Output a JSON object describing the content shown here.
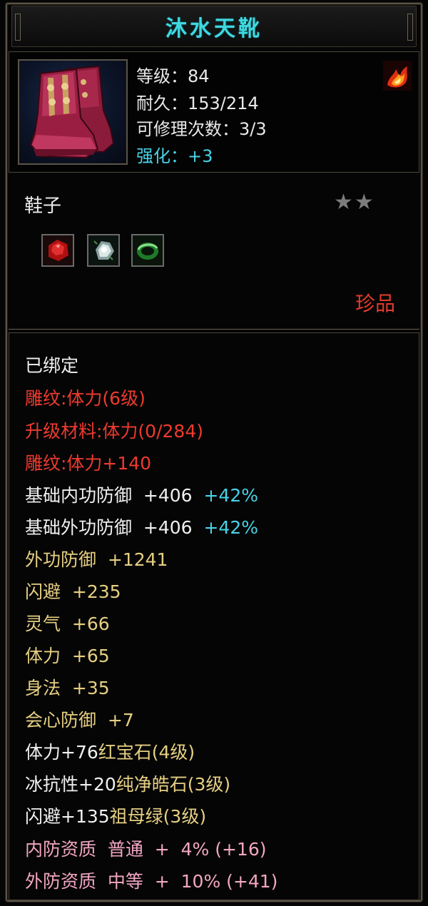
{
  "title": "沐水天靴",
  "header": {
    "level": "等级：84",
    "durability": "耐久：153/214",
    "repair_count": "可修理次数：3/3",
    "enhance": "强化：+3"
  },
  "item_type": "鞋子",
  "stars": "★★",
  "gems": [
    {
      "name": "red-ruby-gem-icon",
      "color": "#c01818"
    },
    {
      "name": "white-diamond-gem-icon",
      "color": "#d8e4e4"
    },
    {
      "name": "green-emerald-gem-icon",
      "color": "#2e9a3a"
    }
  ],
  "quality": "珍品",
  "bound": "已绑定",
  "engraving": {
    "line1": "雕纹:体力(6级)",
    "line2": "升级材料:体力(0/284)",
    "line3": "雕纹:体力+140"
  },
  "base_stats": [
    {
      "label": "基础内功防御  +406",
      "bonus": "+42%"
    },
    {
      "label": "基础外功防御  +406",
      "bonus": "+42%"
    }
  ],
  "attributes": [
    "外功防御  +1241",
    "闪避  +235",
    "灵气  +66",
    "体力  +65",
    "身法  +35",
    "会心防御  +7"
  ],
  "sockets": [
    {
      "stat": "体力+76",
      "gem": "红宝石(4级)"
    },
    {
      "stat": "冰抗性+20",
      "gem": "纯净皓石(3级)"
    },
    {
      "stat": "闪避+135",
      "gem": "祖母绿(3级)"
    }
  ],
  "aptitude": [
    "内防资质  普通  +  4% (+16)",
    "外防资质  中等  +  10% (+41)"
  ],
  "colors": {
    "title": "#3fd8e0",
    "red": "#ee3a2e",
    "yellow": "#e6cf82",
    "cyan": "#48d2e6",
    "pink": "#f2a6c2"
  }
}
